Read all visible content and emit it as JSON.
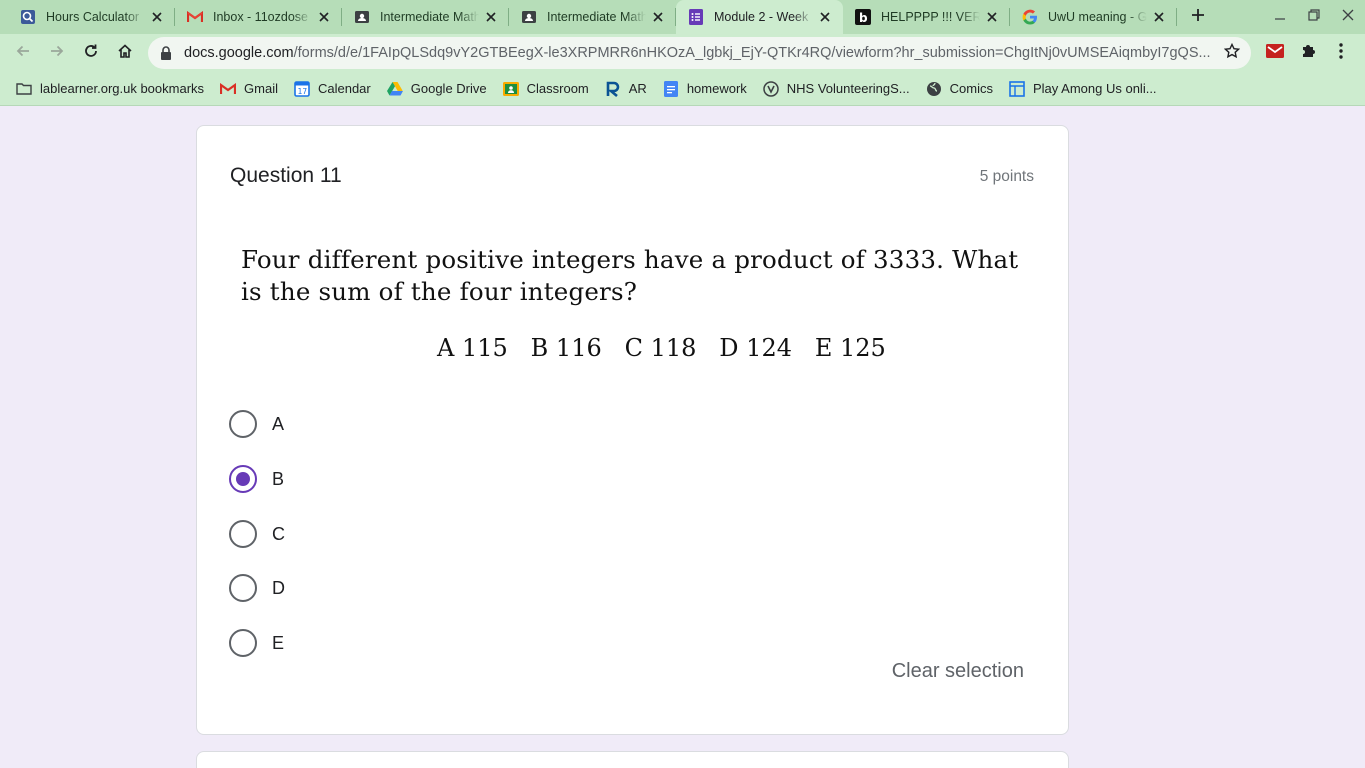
{
  "browser": {
    "tabs": [
      {
        "title": "Hours Calculator",
        "icon": "search-icon",
        "active": false
      },
      {
        "title": "Inbox - 11ozdose",
        "icon": "gmail-icon",
        "active": false
      },
      {
        "title": "Intermediate Math",
        "icon": "classroom-icon",
        "active": false
      },
      {
        "title": "Intermediate Math",
        "icon": "classroom-icon",
        "active": false
      },
      {
        "title": "Module 2 - Week",
        "icon": "forms-icon",
        "active": true
      },
      {
        "title": "HELPPPP !!! VERY",
        "icon": "brainly-icon",
        "active": false
      },
      {
        "title": "UwU meaning - G",
        "icon": "google-icon",
        "active": false
      }
    ],
    "url": {
      "host": "docs.google.com",
      "path": "/forms/d/e/1FAIpQLSdq9vY2GTBEegX-le3XRPMRR6nHKOzA_lgbkj_EjY-QTKr4RQ/viewform?hr_submission=ChgItNj0vUMSEAiqmbyI7gQS..."
    },
    "bookmarks": [
      {
        "label": "lablearner.org.uk bookmarks",
        "icon": "folder-icon"
      },
      {
        "label": "Gmail",
        "icon": "gmail-icon"
      },
      {
        "label": "Calendar",
        "icon": "calendar-icon"
      },
      {
        "label": "Google Drive",
        "icon": "drive-icon"
      },
      {
        "label": "Classroom",
        "icon": "classroom-icon"
      },
      {
        "label": "AR",
        "icon": "ar-icon"
      },
      {
        "label": "homework",
        "icon": "docs-icon"
      },
      {
        "label": "NHS VolunteeringS...",
        "icon": "volunteer-icon"
      },
      {
        "label": "Comics",
        "icon": "globe-icon"
      },
      {
        "label": "Play Among Us onli...",
        "icon": "game-icon"
      }
    ],
    "colors": {
      "frame": "#b6ddb8",
      "toolbar": "#cdeccf",
      "accent": "#673ab7"
    }
  },
  "question": {
    "title": "Question 11",
    "points": "5 points",
    "text": "Four different positive integers have a product of 3333. What is the sum of the four integers?",
    "choices_line": "A 115   B 116   C 118   D 124   E 125",
    "options": [
      {
        "label": "A",
        "selected": false
      },
      {
        "label": "B",
        "selected": true
      },
      {
        "label": "C",
        "selected": false
      },
      {
        "label": "D",
        "selected": false
      },
      {
        "label": "E",
        "selected": false
      }
    ],
    "clear_label": "Clear selection"
  }
}
